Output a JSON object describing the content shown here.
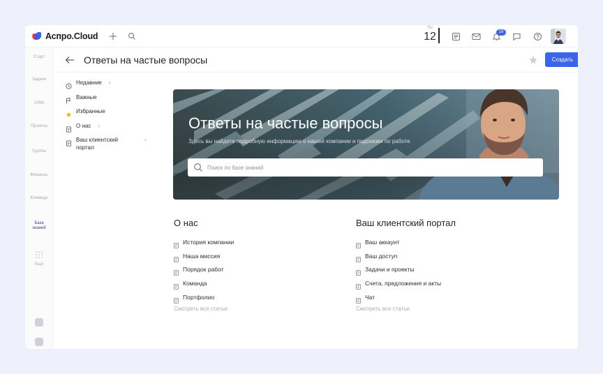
{
  "app": {
    "logo_text": "Аспро.Cloud"
  },
  "topbar": {
    "date_dow": "Пн",
    "date_num": "12",
    "notifications_count": "19"
  },
  "rail": {
    "items": [
      {
        "label": "Старт",
        "icon": "home-icon"
      },
      {
        "label": "Задачи",
        "icon": "check-icon"
      },
      {
        "label": "CRM",
        "icon": "crm-icon"
      },
      {
        "label": "Проекты",
        "icon": "projects-icon"
      },
      {
        "label": "Группы",
        "icon": "groups-icon"
      },
      {
        "label": "Финансы",
        "icon": "finance-icon"
      },
      {
        "label": "Команда",
        "icon": "team-icon"
      },
      {
        "label": "База знаний",
        "icon": "knowledge-icon",
        "active": true
      },
      {
        "label": "Ещё",
        "icon": "grid-icon"
      }
    ]
  },
  "header": {
    "title": "Ответы на частые вопросы",
    "create_label": "Создать"
  },
  "nav": {
    "items": [
      {
        "label": "Недавние",
        "icon": "clock-icon",
        "chevron": "›"
      },
      {
        "label": "Важные",
        "icon": "flag-icon",
        "chevron": ""
      },
      {
        "label": "Избранные",
        "icon": "star-icon",
        "chevron": ""
      },
      {
        "label": "О нас",
        "icon": "doc-icon",
        "chevron": "›"
      },
      {
        "label": "Ваш клиентский портал",
        "icon": "doc-icon",
        "chevron": "›"
      }
    ]
  },
  "hero": {
    "title": "Ответы на частые вопросы",
    "subtitle": "Здесь вы найдете подробную информацию о нашей компании и подсказки по работе",
    "search_placeholder": "Поиск по базе знаний"
  },
  "sections": [
    {
      "title": "О нас",
      "articles": [
        "История компании",
        "Наша миссия",
        "Порядок работ",
        "Команда",
        "Портфолио"
      ],
      "see_all": "Смотреть все статьи"
    },
    {
      "title": "Ваш клиентский портал",
      "articles": [
        "Ваш аккаунт",
        "Ваш доступ",
        "Задачи и проекты",
        "Счета, предложения и акты",
        "Чат"
      ],
      "see_all": "Смотреть все статьи"
    }
  ],
  "colors": {
    "accent": "#3a64ea",
    "background": "#eef0fb"
  }
}
